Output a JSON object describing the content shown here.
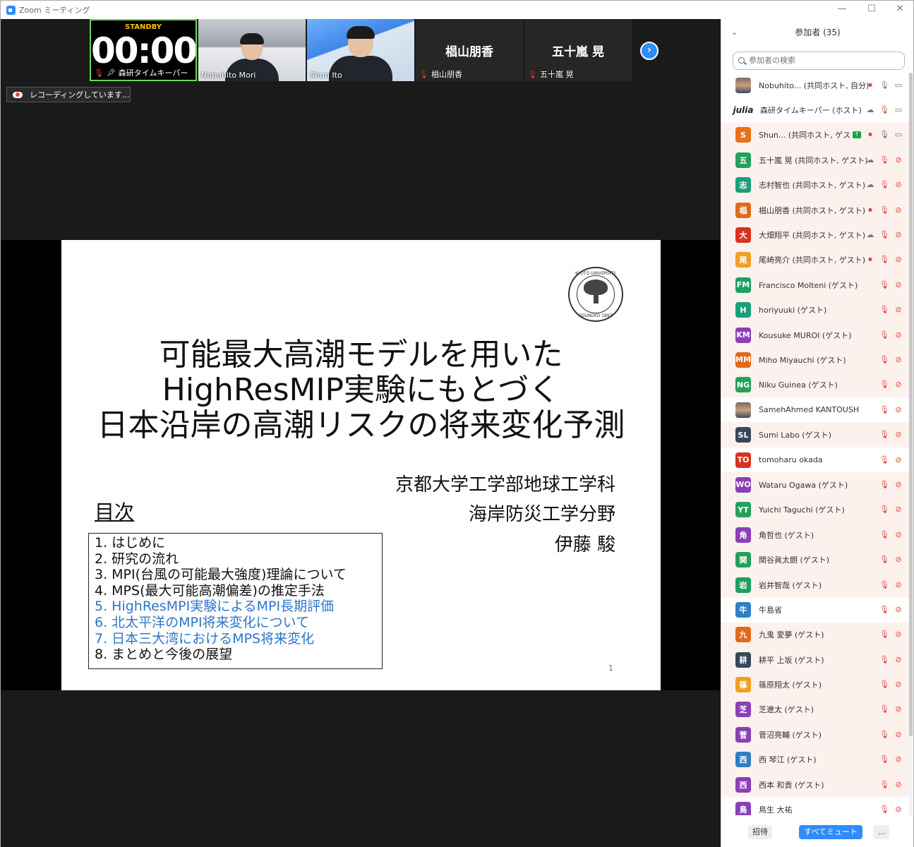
{
  "window": {
    "title": "Zoom ミーティング",
    "minimize": "—",
    "maximize": "☐",
    "close": "✕"
  },
  "videos": {
    "timer": {
      "standby": "STANDBY",
      "clock": "00:00",
      "caption": "森研タイムキーパー"
    },
    "tiles": [
      {
        "caption": "Nobuhito Mori"
      },
      {
        "caption": "Shun Ito"
      },
      {
        "bigname": "椙山朋香",
        "caption": "椙山朋香"
      },
      {
        "bigname": "五十嵐 晃",
        "caption": "五十嵐 晃"
      }
    ],
    "next_glyph": "›"
  },
  "recording": {
    "label": "レコーディングしています..."
  },
  "slide": {
    "seal": {
      "top": "KYOTO UNIVERSITY",
      "bottom": "FOUNDED 1897"
    },
    "title_lines": [
      "可能最大高潮モデルを用いた",
      "HighResMIP実験にもとづく",
      "日本沿岸の高潮リスクの将来変化予測"
    ],
    "affiliation": [
      "京都大学工学部地球工学科",
      "海岸防災工学分野",
      "伊藤 駿"
    ],
    "toc_heading": "目次",
    "toc": [
      {
        "text": "1.  はじめに",
        "highlight": false
      },
      {
        "text": "2.  研究の流れ",
        "highlight": false
      },
      {
        "text": "3.  MPI(台風の可能最大強度)理論について",
        "highlight": false
      },
      {
        "text": "4.  MPS(最大可能高潮偏差)の推定手法",
        "highlight": false
      },
      {
        "text": "5.  HighResMPI実験によるMPI長期評価",
        "highlight": true
      },
      {
        "text": "6.  北太平洋のMPI将来変化について",
        "highlight": true
      },
      {
        "text": "7.  日本三大湾におけるMPS将来変化",
        "highlight": true
      },
      {
        "text": "8.  まとめと今後の展望",
        "highlight": false
      }
    ],
    "page_number": "1",
    "highlight_color": "#2e75c6"
  },
  "participants": {
    "header": "参加者 (35)",
    "search_placeholder": "参加者の検索",
    "list": [
      {
        "avatar": "",
        "avatar_type": "photo",
        "color": "",
        "name": "Nobuhito... (共同ホスト, 自分)",
        "tinted": false,
        "icons": [
          "rec",
          "mic",
          "cam"
        ]
      },
      {
        "avatar": "julia",
        "avatar_type": "julia",
        "color": "",
        "name": "森研タイムキーパー (ホスト)",
        "tinted": false,
        "icons": [
          "cloud",
          "mute",
          "cam"
        ]
      },
      {
        "avatar": "S",
        "avatar_type": "letter",
        "color": "#e8711c",
        "name": "Shun... (共同ホスト, ゲスト)",
        "tinted": true,
        "icons": [
          "share",
          "rec",
          "mic",
          "cam"
        ]
      },
      {
        "avatar": "五",
        "avatar_type": "letter",
        "color": "#24a15a",
        "name": "五十嵐 晃 (共同ホスト, ゲスト)",
        "tinted": true,
        "icons": [
          "cloud",
          "mute",
          "vidoff"
        ]
      },
      {
        "avatar": "志",
        "avatar_type": "letter",
        "color": "#1c9e7a",
        "name": "志村智也 (共同ホスト, ゲスト)",
        "tinted": true,
        "icons": [
          "cloud",
          "mute",
          "vidoff"
        ]
      },
      {
        "avatar": "椙",
        "avatar_type": "letter",
        "color": "#e06a1b",
        "name": "椙山朋香 (共同ホスト, ゲスト)",
        "tinted": true,
        "icons": [
          "rec",
          "mute",
          "vidoff"
        ]
      },
      {
        "avatar": "大",
        "avatar_type": "letter",
        "color": "#d8321f",
        "name": "大畑翔平 (共同ホスト, ゲスト)",
        "tinted": true,
        "icons": [
          "cloud",
          "mute",
          "vidoff"
        ]
      },
      {
        "avatar": "尾",
        "avatar_type": "letter",
        "color": "#f0a024",
        "name": "尾崎亮介 (共同ホスト, ゲスト)",
        "tinted": true,
        "icons": [
          "rec",
          "mute",
          "vidoff"
        ]
      },
      {
        "avatar": "FM",
        "avatar_type": "letter",
        "color": "#1fa061",
        "name": "Francisco Molteni (ゲスト)",
        "tinted": true,
        "icons": [
          "mute",
          "vidoff"
        ]
      },
      {
        "avatar": "H",
        "avatar_type": "letter",
        "color": "#1c9e7a",
        "name": "horiyuuki (ゲスト)",
        "tinted": true,
        "icons": [
          "mute",
          "vidoff"
        ]
      },
      {
        "avatar": "KM",
        "avatar_type": "letter",
        "color": "#8b3fb8",
        "name": "Kousuke MUROI (ゲスト)",
        "tinted": true,
        "icons": [
          "mute",
          "vidoff"
        ]
      },
      {
        "avatar": "MM",
        "avatar_type": "letter",
        "color": "#e06a1b",
        "name": "Miho Miyauchi (ゲスト)",
        "tinted": true,
        "icons": [
          "mute",
          "vidoff"
        ]
      },
      {
        "avatar": "NG",
        "avatar_type": "letter",
        "color": "#24a15a",
        "name": "Niku Guinea (ゲスト)",
        "tinted": true,
        "icons": [
          "mute",
          "vidoff"
        ]
      },
      {
        "avatar": "",
        "avatar_type": "photo",
        "color": "",
        "name": "SamehAhmed KANTOUSH",
        "tinted": false,
        "icons": [
          "mute",
          "vidoff"
        ]
      },
      {
        "avatar": "SL",
        "avatar_type": "letter",
        "color": "#37475a",
        "name": "Sumi Labo (ゲスト)",
        "tinted": true,
        "icons": [
          "mute",
          "vidoff"
        ]
      },
      {
        "avatar": "TO",
        "avatar_type": "letter",
        "color": "#d8321f",
        "name": "tomoharu okada",
        "tinted": false,
        "icons": [
          "mute",
          "vidoff"
        ]
      },
      {
        "avatar": "WO",
        "avatar_type": "letter",
        "color": "#8b3fb8",
        "name": "Wataru Ogawa (ゲスト)",
        "tinted": true,
        "icons": [
          "mute",
          "vidoff"
        ]
      },
      {
        "avatar": "YT",
        "avatar_type": "letter",
        "color": "#24a15a",
        "name": "Yuichi Taguchi (ゲスト)",
        "tinted": true,
        "icons": [
          "mute",
          "vidoff"
        ]
      },
      {
        "avatar": "角",
        "avatar_type": "letter",
        "color": "#8b3fb8",
        "name": "角哲也 (ゲスト)",
        "tinted": true,
        "icons": [
          "mute",
          "vidoff"
        ]
      },
      {
        "avatar": "関",
        "avatar_type": "letter",
        "color": "#24a15a",
        "name": "関谷眞太朗 (ゲスト)",
        "tinted": true,
        "icons": [
          "mute",
          "vidoff"
        ]
      },
      {
        "avatar": "岩",
        "avatar_type": "letter",
        "color": "#1fa061",
        "name": "岩井智哉 (ゲスト)",
        "tinted": true,
        "icons": [
          "mute",
          "vidoff"
        ]
      },
      {
        "avatar": "牛",
        "avatar_type": "letter",
        "color": "#2f7fc4",
        "name": "牛島省",
        "tinted": false,
        "icons": [
          "mute",
          "vidoff"
        ]
      },
      {
        "avatar": "九",
        "avatar_type": "letter",
        "color": "#e06a1b",
        "name": "九鬼 愛夢 (ゲスト)",
        "tinted": true,
        "icons": [
          "mute",
          "vidoff"
        ]
      },
      {
        "avatar": "耕",
        "avatar_type": "letter",
        "color": "#37475a",
        "name": "耕平 上坂 (ゲスト)",
        "tinted": true,
        "icons": [
          "mute",
          "vidoff"
        ]
      },
      {
        "avatar": "篠",
        "avatar_type": "letter",
        "color": "#f0a024",
        "name": "篠原翔太 (ゲスト)",
        "tinted": true,
        "icons": [
          "mute",
          "vidoff"
        ]
      },
      {
        "avatar": "芝",
        "avatar_type": "letter",
        "color": "#8b3fb8",
        "name": "芝遼太 (ゲスト)",
        "tinted": true,
        "icons": [
          "mute",
          "vidoff"
        ]
      },
      {
        "avatar": "菅",
        "avatar_type": "letter",
        "color": "#8b3fb8",
        "name": "菅沼亮輔 (ゲスト)",
        "tinted": true,
        "icons": [
          "mute",
          "vidoff"
        ]
      },
      {
        "avatar": "西",
        "avatar_type": "letter",
        "color": "#2f7fc4",
        "name": "西 琴江 (ゲスト)",
        "tinted": true,
        "icons": [
          "mute",
          "vidoff"
        ]
      },
      {
        "avatar": "西",
        "avatar_type": "letter",
        "color": "#8b3fb8",
        "name": "西本 和貴 (ゲスト)",
        "tinted": true,
        "icons": [
          "mute",
          "vidoff"
        ]
      },
      {
        "avatar": "鳥",
        "avatar_type": "letter",
        "color": "#8b3fb8",
        "name": "鳥生 大祐",
        "tinted": false,
        "icons": [
          "mute",
          "vidoff"
        ]
      }
    ],
    "footer": {
      "invite": "招待",
      "mute_all": "すべてミュート",
      "more": "..."
    },
    "accent": "#2d8cff"
  }
}
